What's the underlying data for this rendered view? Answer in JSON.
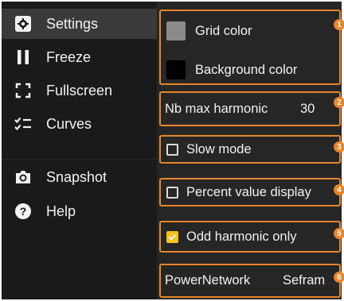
{
  "sidebar": {
    "items": [
      {
        "label": "Settings",
        "icon": "gear-icon",
        "active": true
      },
      {
        "label": "Freeze",
        "icon": "pause-icon"
      },
      {
        "label": "Fullscreen",
        "icon": "fullscreen-icon"
      },
      {
        "label": "Curves",
        "icon": "checklist-icon"
      },
      {
        "label": "Snapshot",
        "icon": "camera-icon"
      },
      {
        "label": "Help",
        "icon": "help-icon"
      }
    ]
  },
  "settings": {
    "grid_color": {
      "label": "Grid color",
      "color": "#8a8a8a"
    },
    "background_color": {
      "label": "Background color",
      "color": "#000000"
    },
    "nb_max_harmonic": {
      "label": "Nb max harmonic",
      "value": "30"
    },
    "slow_mode": {
      "label": "Slow mode",
      "checked": false
    },
    "percent_value_display": {
      "label": "Percent value display",
      "checked": false
    },
    "odd_harmonic_only": {
      "label": "Odd harmonic only",
      "checked": true
    },
    "power_network": {
      "label": "PowerNetwork",
      "value": "Sefram"
    }
  },
  "callouts": [
    "1",
    "2",
    "3",
    "4",
    "5",
    "6"
  ],
  "colors": {
    "accent": "#e8852a",
    "checkbox_checked": "#f7c21a"
  }
}
